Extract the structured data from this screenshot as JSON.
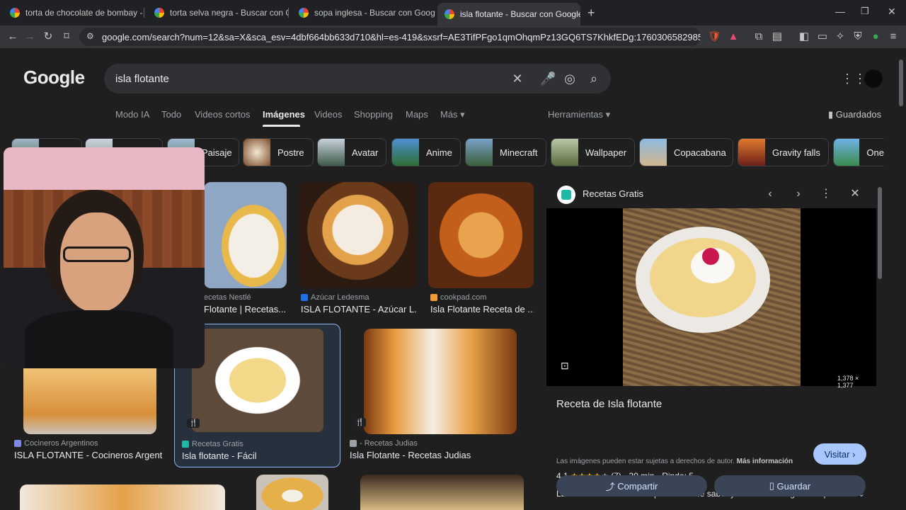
{
  "browser": {
    "tabs": [
      {
        "label": "torta de chocolate de bombay - Busc"
      },
      {
        "label": "torta selva negra - Buscar con Googl"
      },
      {
        "label": "sopa inglesa - Buscar con Google"
      },
      {
        "label": "isla flotante - Buscar con Google"
      }
    ],
    "new_tab": "+",
    "url": "google.com/search?num=12&sa=X&sca_esv=4dbf664bb633d710&hl=es-419&sxsrf=AE3TifPFgo1qmOhqmPz13GQ6TS7KhkfEDg:1760306582985&udm=2&fbs=..."
  },
  "google": {
    "logo": "Google",
    "query": "isla flotante",
    "tabs": [
      "Modo IA",
      "Todo",
      "Videos cortos",
      "Imágenes",
      "Videos",
      "Shopping",
      "Maps",
      "Más"
    ],
    "tools": "Herramientas",
    "saved": "Guardados",
    "chips": [
      "Paisaje",
      "Postre",
      "Avatar",
      "Anime",
      "Minecraft",
      "Wallpaper",
      "Copacabana",
      "Gravity falls",
      "One"
    ]
  },
  "results": [
    {
      "source": "ecetas Nestlé",
      "title": "Flotante | Recetas..."
    },
    {
      "source": "Azúcar Ledesma",
      "title": "ISLA FLOTANTE - Azúcar L..."
    },
    {
      "source": "cookpad.com",
      "title": "Isla Flotante Receta de ..."
    },
    {
      "source": "Cocineros Argentinos",
      "title": "ISLA FLOTANTE - Cocineros Argenti..."
    },
    {
      "source": "Recetas Gratis",
      "title": "Isla flotante - Fácil"
    },
    {
      "source": "- Recetas Judias",
      "title": "Isla Flotante - Recetas Judias"
    }
  ],
  "panel": {
    "source": "Recetas Gratis",
    "dimensions": "1,378 × 1,377",
    "title": "Receta de Isla flotante",
    "visit": "Visitar",
    "rating": "4.1",
    "stars": "★★★★",
    "half_star": "★",
    "reviews": "(7)",
    "time": "30 min",
    "yield": "Rinde: 5",
    "description": "Las islas flotantes son un plato lleno de sabor y textura! Su origen europe...",
    "more": "Más",
    "copyright": "Las imágenes pueden estar sujetas a derechos de autor.",
    "more_info": "Más información",
    "share": "Compartir",
    "save": "Guardar"
  },
  "colors": {
    "accent_blue": "#a8c7fa",
    "background": "#1f1f1f",
    "selected_border": "#8ab4f8"
  }
}
